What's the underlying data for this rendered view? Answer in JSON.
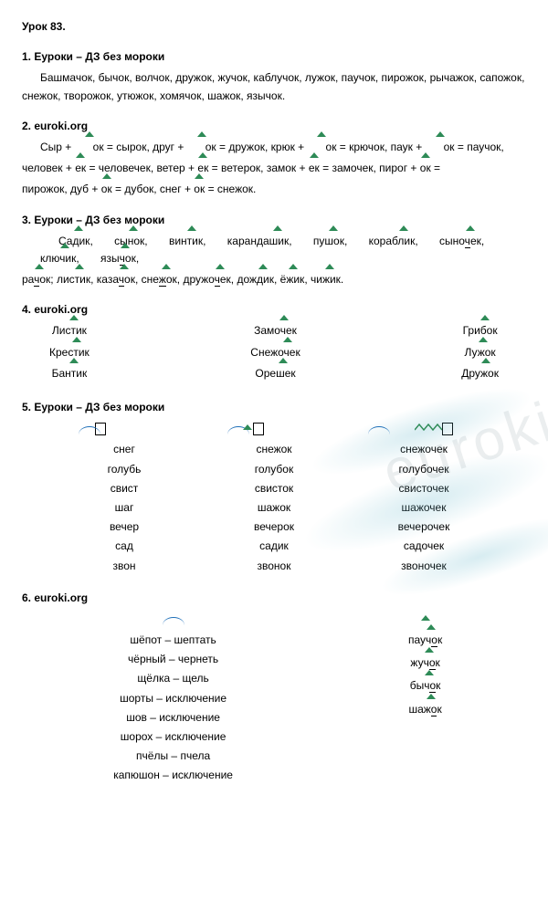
{
  "title": "Урок 83.",
  "watermark": "euroki",
  "s1": {
    "heading": "1. Еуроки – ДЗ без мороки",
    "text": "Башмачок, бычок, волчок, дружок, жучок, каблучок, лужок, паучок, пирожок, рычажок, сапожок, снежок, творожок, утюжок, хомячок, шажок, язычок."
  },
  "s2": {
    "heading": "2. euroki.org",
    "p1a": "Сыр + ",
    "ok1": "ок",
    "p1b": " = сырок, друг + ",
    "ok2": "ок",
    "p1c": " = дружок, крюк + ",
    "ok3": "ок",
    "p1d": " = крючок, паук + ",
    "ok4": "ок",
    "p1e": " = паучок,",
    "p2a": "человек + ",
    "ek1": "ек",
    "p2b": " = человечек, ветер + ",
    "ek2": "ек",
    "p2c": " = ветерок, замок + ",
    "ek3": "ек",
    "p2d": " = замочек, пирог + ",
    "ok5": "ок",
    "p2e": " =",
    "p3a": "пирожок, дуб + ",
    "ok6": "ок",
    "p3b": " = дубок, снег + ",
    "ok7": "ок",
    "p3c": " = снежок."
  },
  "s3": {
    "heading": "3. Еуроки – ДЗ без мороки",
    "line1": {
      "w1": "Садик",
      "w2": "сынок",
      "w3": "винтик",
      "w4": "карандашик",
      "w5": "пушок",
      "w6": "кораблик",
      "w7": "сыночек",
      "w8": "ключик",
      "w9": "язычок"
    },
    "line2": {
      "w1": "рачок",
      "w2": "листик",
      "w3": "казачок",
      "w4": "снежок",
      "w5": "дружочек",
      "w6": "дождик",
      "w7": "ёжик",
      "w8": "чижик"
    }
  },
  "s4": {
    "heading": "4. euroki.org",
    "col1": [
      "Листик",
      "Крестик",
      "Бантик"
    ],
    "col2": [
      "Замочек",
      "Снежочек",
      "Орешек"
    ],
    "col3": [
      "Грибок",
      "Лужок",
      "Дружок"
    ]
  },
  "s5": {
    "heading": "5. Еуроки – ДЗ без мороки",
    "col1": [
      "снег",
      "голубь",
      "свист",
      "шаг",
      "вечер",
      "сад",
      "звон"
    ],
    "col2": [
      "снежок",
      "голубок",
      "свисток",
      "шажок",
      "вечерок",
      "садик",
      "звонок"
    ],
    "col3": [
      "снежочек",
      "голубочек",
      "свисточек",
      "шажочек",
      "вечерочек",
      "садочек",
      "звоночек"
    ]
  },
  "s6": {
    "heading": "6. euroki.org",
    "left": [
      "шёпот – шептать",
      "чёрный – чернеть",
      "щёлка – щель",
      "шорты – исключение",
      "шов – исключение",
      "шорох – исключение",
      "пчёлы – пчела",
      "капюшон – исключение"
    ],
    "right": [
      "паучок",
      "жучок",
      "бычок",
      "шажок"
    ]
  }
}
